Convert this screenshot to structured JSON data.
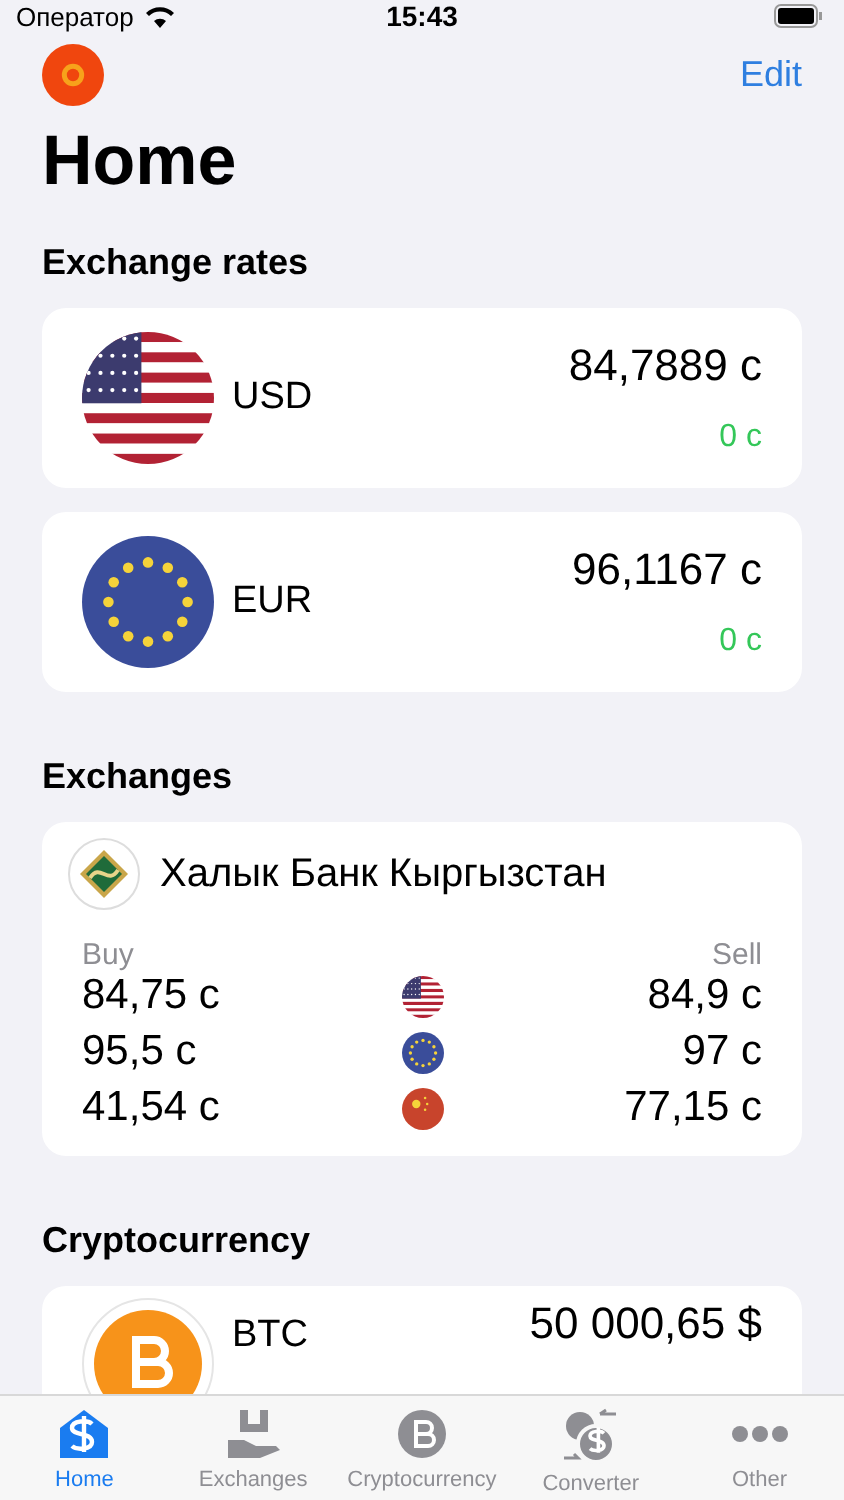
{
  "status_bar": {
    "carrier": "Оператор",
    "time": "15:43"
  },
  "nav": {
    "edit": "Edit"
  },
  "title": "Home",
  "rates_heading": "Exchange rates",
  "rates": [
    {
      "code": "USD",
      "value": "84,7889 с",
      "change": "0 с"
    },
    {
      "code": "EUR",
      "value": "96,1167 с",
      "change": "0 с"
    }
  ],
  "exchanges_heading": "Exchanges",
  "bank": {
    "name": "Халык Банк Кыргызстан",
    "buy_label": "Buy",
    "sell_label": "Sell",
    "rows": [
      {
        "buy": "84,75 с",
        "sell": "84,9 с"
      },
      {
        "buy": "95,5 с",
        "sell": "97 с"
      },
      {
        "buy": "41,54 с",
        "sell": "77,15 с"
      }
    ]
  },
  "crypto_heading": "Cryptocurrency",
  "crypto": [
    {
      "code": "BTC",
      "value": "50 000,65 $"
    }
  ],
  "tabs": [
    {
      "label": "Home",
      "selected": true
    },
    {
      "label": "Exchanges",
      "selected": false
    },
    {
      "label": "Cryptocurrency",
      "selected": false
    },
    {
      "label": "Converter",
      "selected": false
    },
    {
      "label": "Other",
      "selected": false
    }
  ]
}
